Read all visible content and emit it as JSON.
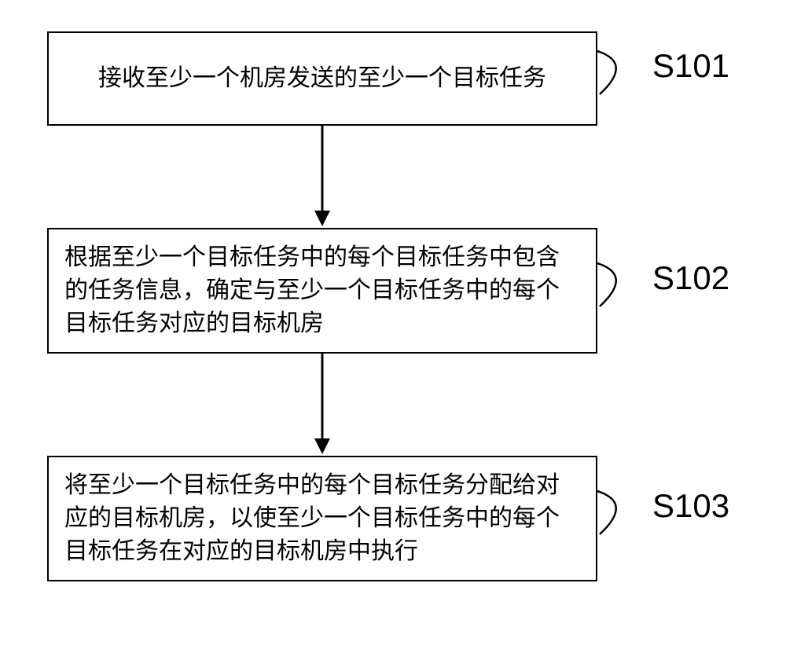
{
  "flowchart": {
    "steps": [
      {
        "id": "S101",
        "text": "接收至少一个机房发送的至少一个目标任务"
      },
      {
        "id": "S102",
        "text": "根据至少一个目标任务中的每个目标任务中包含的任务信息，确定与至少一个目标任务中的每个目标任务对应的目标机房"
      },
      {
        "id": "S103",
        "text": "将至少一个目标任务中的每个目标任务分配给对应的目标机房，以使至少一个目标任务中的每个目标任务在对应的目标机房中执行"
      }
    ]
  }
}
